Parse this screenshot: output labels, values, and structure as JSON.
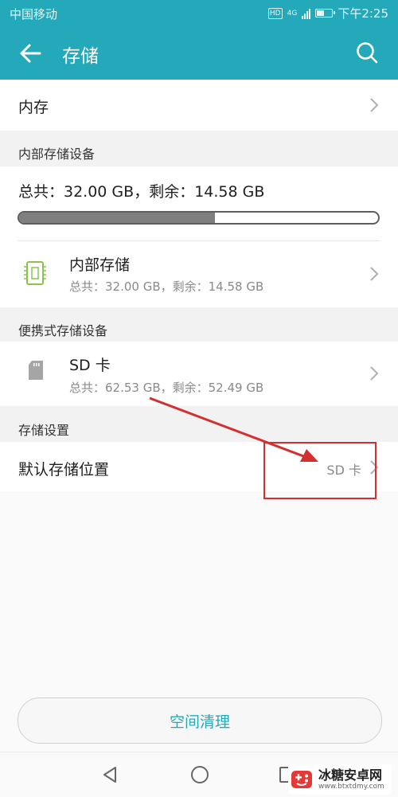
{
  "status_bar": {
    "carrier": "中国移动",
    "network": "4G",
    "hd": "HD",
    "time": "下午2:25"
  },
  "app_bar": {
    "title": "存储"
  },
  "memory_row": {
    "label": "内存"
  },
  "internal_section": {
    "header": "内部存储设备",
    "summary": "总共：32.00 GB，剩余：14.58 GB",
    "used_fraction": 0.545,
    "item": {
      "title": "内部存储",
      "subtitle": "总共：32.00 GB，剩余：14.58 GB"
    }
  },
  "portable_section": {
    "header": "便携式存储设备",
    "item": {
      "title": "SD 卡",
      "subtitle": "总共：62.53 GB，剩余：52.49 GB"
    }
  },
  "settings_section": {
    "header": "存储设置",
    "default_location": {
      "label": "默认存储位置",
      "value": "SD 卡"
    }
  },
  "clean_button": {
    "label": "空间清理"
  },
  "watermark": {
    "title": "冰糖安卓网",
    "url": "www.btxtdmy.com"
  },
  "colors": {
    "accent": "#23a9ba",
    "annotation": "#d32f2f",
    "chip_icon": "#8bc34a"
  }
}
